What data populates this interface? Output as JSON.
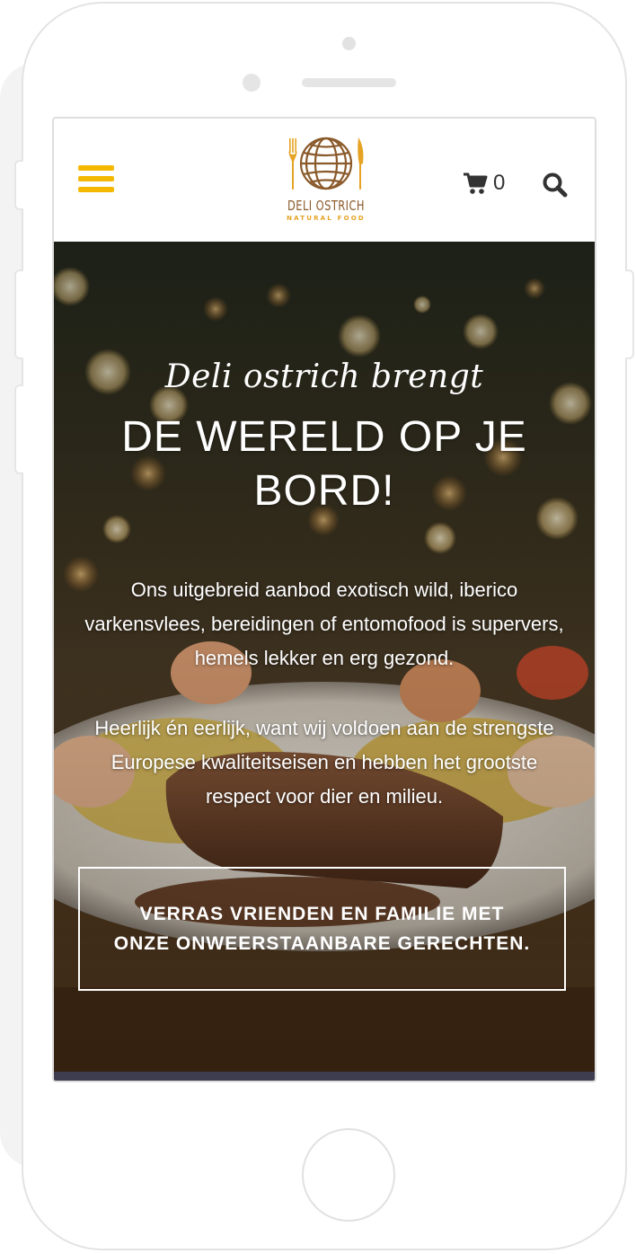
{
  "colors": {
    "accent": "#f5b800",
    "logo_brown": "#8a5a2b",
    "logo_gold": "#e6a323",
    "icon_dark": "#333333",
    "footer_strip": "#3d3d4f"
  },
  "header": {
    "menu_icon": "hamburger-menu-icon",
    "logo": {
      "name": "DELI OSTRICH",
      "tagline": "NATURAL FOOD"
    },
    "cart": {
      "icon": "shopping-cart-icon",
      "count": "0"
    },
    "search_icon": "search-icon"
  },
  "hero": {
    "script_line": "Deli ostrich brengt",
    "title": "DE WERELD OP JE BORD!",
    "paragraph_1": "Ons uitgebreid aanbod exotisch wild, iberico varkensvlees, bereidingen of entomofood is supervers, hemels lekker en erg gezond.",
    "paragraph_2": "Heerlijk én eerlijk, want wij voldoen aan de strengste Europese kwaliteitseisen en hebben het grootste respect voor dier en milieu.",
    "cta_label": "VERRAS VRIENDEN EN FAMILIE MET ONZE ONWEERSTAANBARE GERECHTEN."
  }
}
